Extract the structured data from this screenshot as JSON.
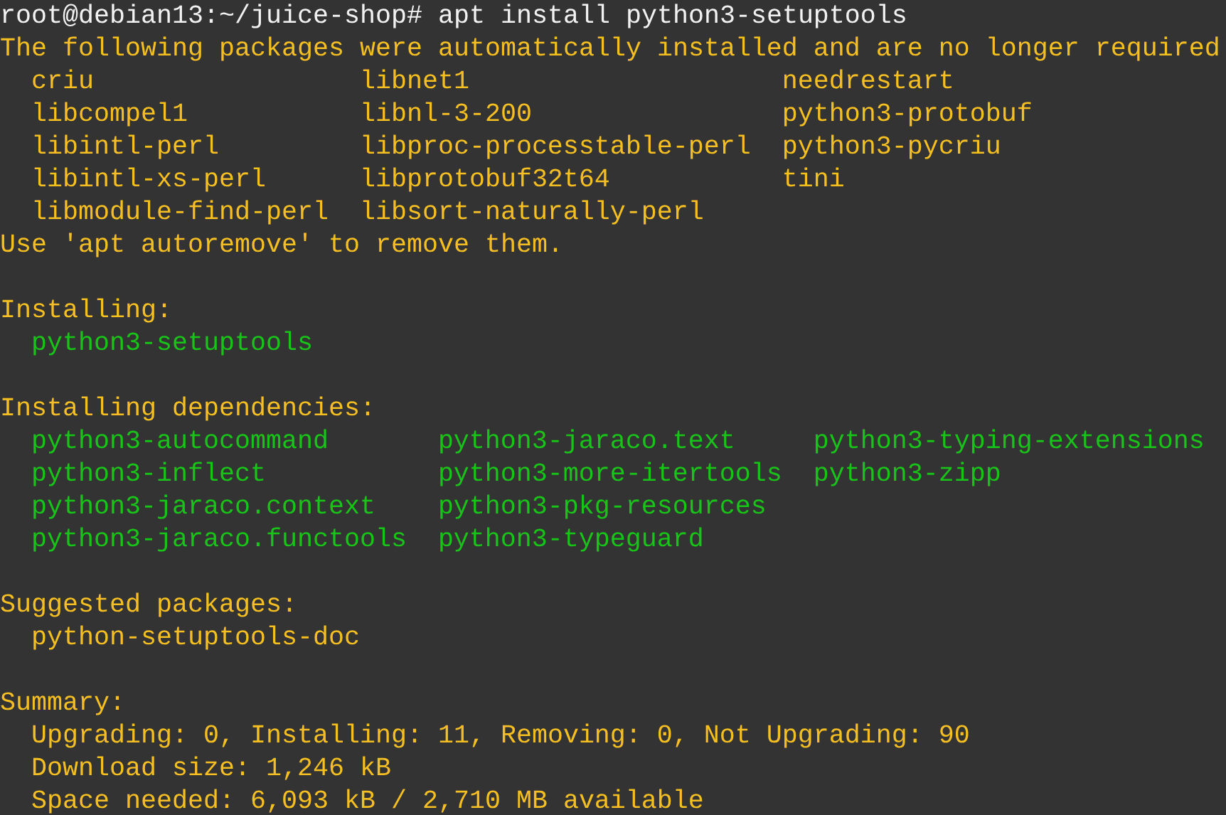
{
  "command_line": {
    "prompt": "root@debian13:~/juice-shop#",
    "command": "apt install python3-setuptools"
  },
  "autoremove_notice": {
    "text": "The following packages were automatically installed and are no longer required",
    "packages": [
      [
        "criu",
        "libnet1",
        "needrestart"
      ],
      [
        "libcompel1",
        "libnl-3-200",
        "python3-protobuf"
      ],
      [
        "libintl-perl",
        "libproc-processtable-perl",
        "python3-pycriu"
      ],
      [
        "libintl-xs-perl",
        "libprotobuf32t64",
        "tini"
      ],
      [
        "libmodule-find-perl",
        "libsort-naturally-perl"
      ]
    ],
    "hint": "Use 'apt autoremove' to remove them."
  },
  "sections": [
    {
      "kind": "install",
      "heading": "Installing:",
      "packages": [
        [
          "python3-setuptools"
        ]
      ]
    },
    {
      "kind": "install",
      "heading": "Installing dependencies:",
      "packages": [
        [
          "python3-autocommand",
          "python3-jaraco.text",
          "python3-typing-extensions"
        ],
        [
          "python3-inflect",
          "python3-more-itertools",
          "python3-zipp"
        ],
        [
          "python3-jaraco.context",
          "python3-pkg-resources"
        ],
        [
          "python3-jaraco.functools",
          "python3-typeguard"
        ]
      ]
    },
    {
      "kind": "suggest",
      "heading": "Suggested packages:",
      "packages": [
        [
          "python-setuptools-doc"
        ]
      ]
    },
    {
      "kind": "summary",
      "heading": "Summary:",
      "lines": [
        "Upgrading: 0, Installing: 11, Removing: 0, Not Upgrading: 90",
        "Download size: 1,246 kB",
        "Space needed: 6,093 kB / 2,710 MB available"
      ]
    }
  ]
}
